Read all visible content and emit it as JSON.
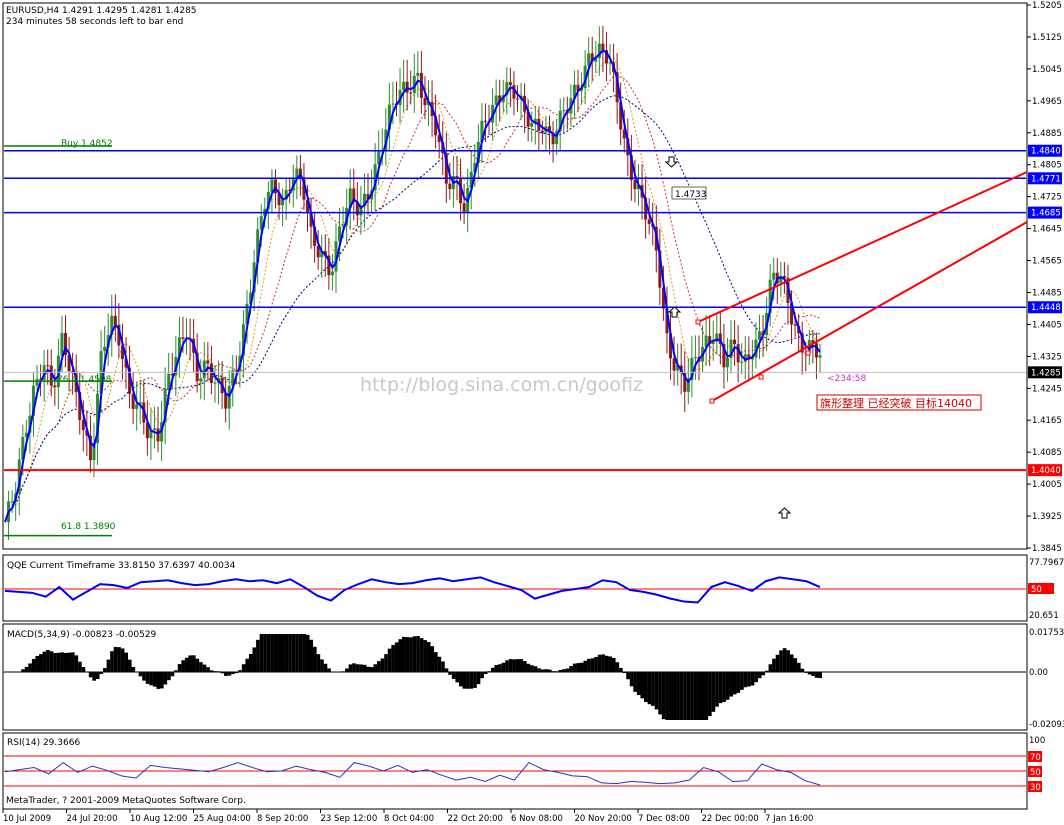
{
  "symbol_info": "EURUSD,H4  1.4291 1.4295 1.4281 1.4285",
  "bar_timer": "234 minutes 58 seconds left to bar end",
  "watermark": "http://blog.sina.com.cn/goofiz",
  "copyright": "MetaTrader, ? 2001-2009 MetaQuotes Software Corp.",
  "annotation_text": "旗形整理 已经突破 目标14040",
  "countdown": "<234:58",
  "hline_labels": [
    "Buy 1.4852",
    "76.4 1.4598",
    "61.8 1.3890",
    "1.4733"
  ],
  "colors": {
    "bull": "#2d8c2d",
    "bear": "#8c1a1a",
    "main_line": "#0000ff",
    "level_blue": "#0000ff",
    "level_red": "#ff0000",
    "fib_green": "#008000",
    "channel": "#ff0000",
    "ma_orange": "#d4a020",
    "ma_red": "#cc3030",
    "ma_navy": "#000080"
  },
  "chart_data": [
    {
      "type": "line",
      "name": "price",
      "title": "EURUSD,H4",
      "ylim": [
        1.3845,
        1.5205
      ],
      "y_ticks": [
        "1.5205",
        "1.5125",
        "1.5045",
        "1.4965",
        "1.4885",
        "1.4805",
        "1.4725",
        "1.4645",
        "1.4565",
        "1.4485",
        "1.4405",
        "1.4325",
        "1.4245",
        "1.4165",
        "1.4085",
        "1.4005",
        "1.3925",
        "1.3845"
      ],
      "x_ticks": [
        "10 Jul 2009",
        "24 Jul 20:00",
        "10 Aug 12:00",
        "25 Aug 04:00",
        "8 Sep 20:00",
        "23 Sep 12:00",
        "8 Oct 04:00",
        "22 Oct 20:00",
        "6 Nov 08:00",
        "20 Nov 20:00",
        "7 Dec 08:00",
        "22 Dec 00:00",
        "7 Jan 16:00"
      ],
      "close": [
        1.391,
        1.397,
        1.412,
        1.425,
        1.432,
        1.423,
        1.436,
        1.428,
        1.418,
        1.405,
        1.43,
        1.442,
        1.438,
        1.423,
        1.418,
        1.412,
        1.414,
        1.428,
        1.433,
        1.438,
        1.428,
        1.432,
        1.426,
        1.42,
        1.428,
        1.442,
        1.458,
        1.47,
        1.474,
        1.471,
        1.48,
        1.476,
        1.46,
        1.458,
        1.455,
        1.466,
        1.471,
        1.468,
        1.475,
        1.484,
        1.492,
        1.497,
        1.5,
        1.504,
        1.495,
        1.488,
        1.476,
        1.478,
        1.47,
        1.482,
        1.49,
        1.496,
        1.501,
        1.499,
        1.493,
        1.49,
        1.492,
        1.487,
        1.491,
        1.496,
        1.502,
        1.509,
        1.508,
        1.506,
        1.495,
        1.482,
        1.474,
        1.466,
        1.458,
        1.438,
        1.43,
        1.424,
        1.431,
        1.436,
        1.44,
        1.431,
        1.434,
        1.43,
        1.436,
        1.439,
        1.451,
        1.452,
        1.444,
        1.436,
        1.434,
        1.432
      ],
      "current_price": "1.4285",
      "price_levels": [
        {
          "value": 1.484,
          "label": "1.4840",
          "color": "#0000ff"
        },
        {
          "value": 1.4771,
          "label": "1.4771",
          "color": "#0000ff"
        },
        {
          "value": 1.4685,
          "label": "1.4685",
          "color": "#0000ff"
        },
        {
          "value": 1.4448,
          "label": "1.4448",
          "color": "#0000ff"
        },
        {
          "value": 1.404,
          "label": "1.4040",
          "color": "#ff0000"
        }
      ],
      "fib_levels": [
        {
          "value": 1.4852,
          "label": "Buy 1.4852"
        },
        {
          "value": 1.4263,
          "label": "76.4 1.4598"
        },
        {
          "value": 1.3876,
          "label": "61.8 1.3890"
        }
      ]
    },
    {
      "type": "line",
      "title": "QQE Current Timeframe 33.8150 37.6397 40.0034",
      "y_ticks": [
        "77.7967",
        "50",
        "20.651"
      ],
      "values": [
        46,
        45,
        44,
        40,
        50,
        37,
        45,
        53,
        52,
        49,
        55,
        56,
        57,
        54,
        52,
        53,
        56,
        58,
        56,
        57,
        54,
        58,
        50,
        41,
        36,
        47,
        53,
        58,
        55,
        53,
        54,
        57,
        59,
        56,
        58,
        60,
        55,
        51,
        47,
        38,
        42,
        46,
        48,
        50,
        57,
        55,
        47,
        45,
        42,
        38,
        35,
        34,
        50,
        55,
        51,
        46,
        56,
        60,
        58,
        56,
        50
      ]
    },
    {
      "type": "bar",
      "title": "MACD(5,34,9) -0.00823 -0.00529",
      "y_ticks": [
        "0.01753",
        "0.00",
        "-0.02093"
      ]
    },
    {
      "type": "line",
      "title": "RSI(14) 29.3666",
      "y_ticks": [
        "100",
        "70",
        "50",
        "30"
      ],
      "values": [
        49,
        52,
        55,
        46,
        62,
        48,
        57,
        51,
        43,
        40,
        58,
        55,
        53,
        51,
        49,
        55,
        62,
        55,
        49,
        50,
        57,
        52,
        48,
        41,
        62,
        57,
        50,
        58,
        48,
        52,
        44,
        37,
        41,
        35,
        44,
        37,
        62,
        52,
        48,
        43,
        42,
        33,
        32,
        35,
        34,
        32,
        33,
        37,
        55,
        49,
        35,
        36,
        60,
        52,
        48,
        36,
        30
      ]
    }
  ]
}
